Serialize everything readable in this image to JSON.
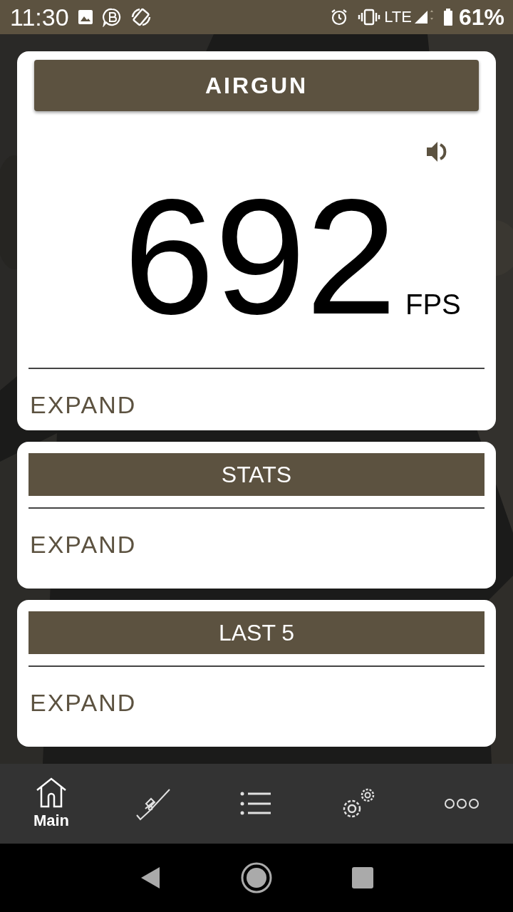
{
  "status_bar": {
    "time": "11:30",
    "network": "LTE",
    "battery": "61%"
  },
  "cards": [
    {
      "kind": "reading",
      "title": "AIRGUN",
      "value": "692",
      "unit": "FPS",
      "sound_on": true,
      "expand": "EXPAND"
    },
    {
      "kind": "panel",
      "title": "STATS",
      "expand": "EXPAND"
    },
    {
      "kind": "panel",
      "title": "LAST 5",
      "expand": "EXPAND"
    }
  ],
  "nav": [
    {
      "kind": "home",
      "label": "Main",
      "selected": true
    },
    {
      "kind": "rifle",
      "selected": false
    },
    {
      "kind": "list",
      "selected": false
    },
    {
      "kind": "gears",
      "selected": false
    },
    {
      "kind": "more",
      "selected": false
    }
  ]
}
